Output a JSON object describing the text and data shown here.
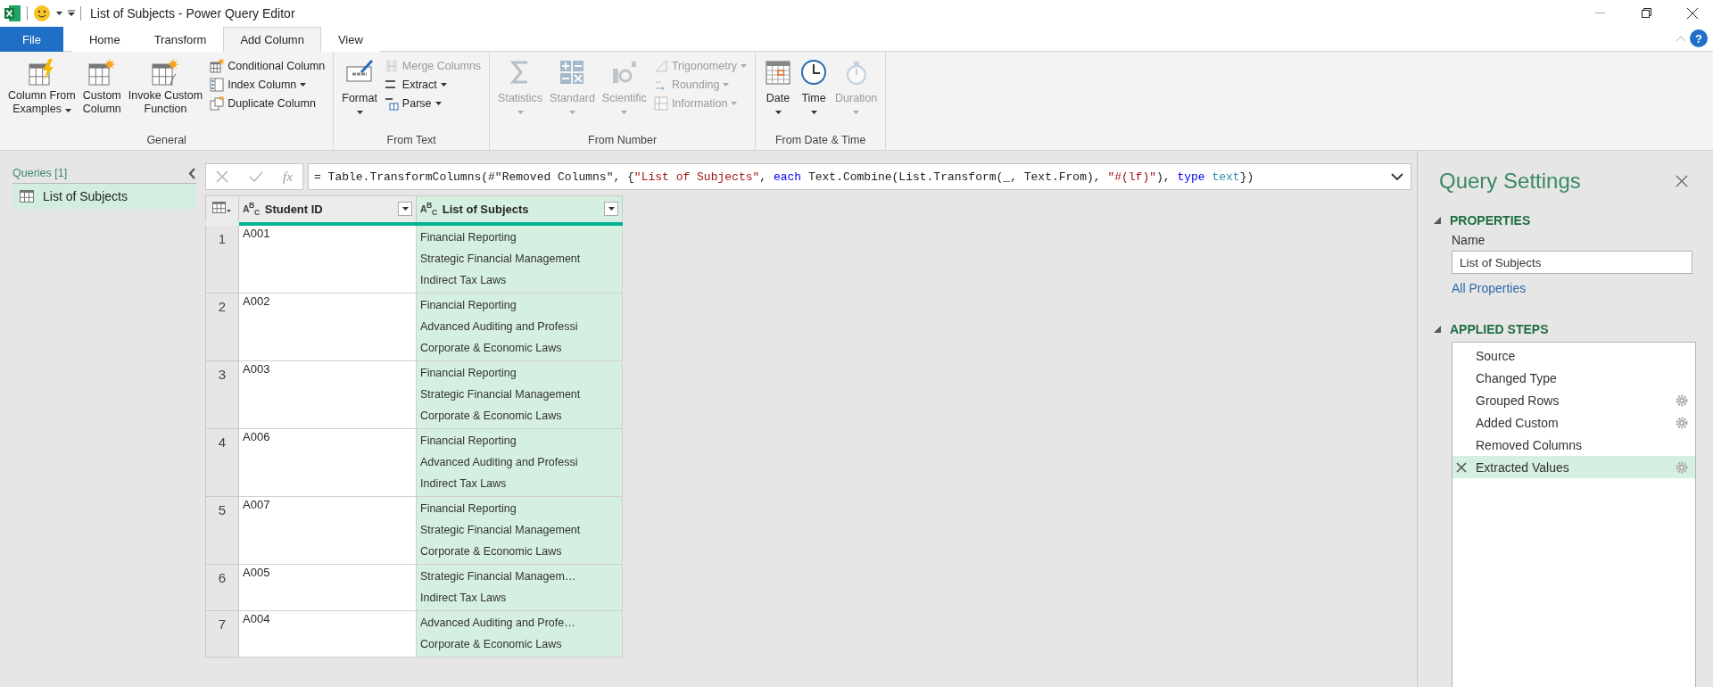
{
  "window": {
    "title": "List of Subjects - Power Query Editor"
  },
  "tabs": [
    {
      "label": "File",
      "kind": "file",
      "selected": false
    },
    {
      "label": "Home",
      "kind": "tab",
      "selected": false
    },
    {
      "label": "Transform",
      "kind": "tab",
      "selected": false
    },
    {
      "label": "Add Column",
      "kind": "tab",
      "selected": true
    },
    {
      "label": "View",
      "kind": "tab",
      "selected": false
    }
  ],
  "help": {
    "label": "?"
  },
  "ribbon_groups": [
    {
      "label": "General",
      "items": [
        {
          "kind": "large",
          "label_lines": [
            "Column From",
            "Examples"
          ],
          "dropdown": true,
          "disabled": false
        },
        {
          "kind": "large",
          "label_lines": [
            "Custom",
            "Column"
          ],
          "dropdown": false,
          "disabled": false
        },
        {
          "kind": "large",
          "label_lines": [
            "Invoke Custom",
            "Function"
          ],
          "dropdown": false,
          "disabled": false
        },
        {
          "kind": "small",
          "label_lines": [
            "Conditional Column"
          ],
          "dropdown": false,
          "disabled": false
        },
        {
          "kind": "small",
          "label_lines": [
            "Index Column"
          ],
          "dropdown": true,
          "disabled": false
        },
        {
          "kind": "small",
          "label_lines": [
            "Duplicate Column"
          ],
          "dropdown": false,
          "disabled": false
        }
      ]
    },
    {
      "label": "From Text",
      "items": [
        {
          "kind": "large",
          "label_lines": [
            "Format"
          ],
          "dropdown": true,
          "disabled": false
        },
        {
          "kind": "small",
          "label_lines": [
            "Merge Columns"
          ],
          "dropdown": false,
          "disabled": true
        },
        {
          "kind": "small",
          "label_lines": [
            "Extract"
          ],
          "dropdown": true,
          "disabled": false
        },
        {
          "kind": "small",
          "label_lines": [
            "Parse"
          ],
          "dropdown": true,
          "disabled": false
        }
      ]
    },
    {
      "label": "From Number",
      "items": [
        {
          "kind": "large",
          "label_lines": [
            "Statistics"
          ],
          "dropdown": true,
          "disabled": true
        },
        {
          "kind": "large",
          "label_lines": [
            "Standard"
          ],
          "dropdown": true,
          "disabled": true
        },
        {
          "kind": "large",
          "label_lines": [
            "Scientific"
          ],
          "dropdown": true,
          "disabled": true
        },
        {
          "kind": "small",
          "label_lines": [
            "Trigonometry"
          ],
          "dropdown": true,
          "disabled": true
        },
        {
          "kind": "small",
          "label_lines": [
            "Rounding"
          ],
          "dropdown": true,
          "disabled": true
        },
        {
          "kind": "small",
          "label_lines": [
            "Information"
          ],
          "dropdown": true,
          "disabled": true
        }
      ]
    },
    {
      "label": "From Date & Time",
      "items": [
        {
          "kind": "large",
          "label_lines": [
            "Date"
          ],
          "dropdown": true,
          "disabled": false
        },
        {
          "kind": "large",
          "label_lines": [
            "Time"
          ],
          "dropdown": true,
          "disabled": false
        },
        {
          "kind": "large",
          "label_lines": [
            "Duration"
          ],
          "dropdown": true,
          "disabled": true
        }
      ]
    }
  ],
  "queries": {
    "title": "Queries [1]",
    "items": [
      {
        "name": "List of Subjects",
        "selected": true
      }
    ]
  },
  "formula_bar": {
    "function_label": "fx",
    "tokens": [
      {
        "text": "= Table.TransformColumns(#\"Removed Columns\", {",
        "kind": "plain"
      },
      {
        "text": "\"List of Subjects\"",
        "kind": "string"
      },
      {
        "text": ", ",
        "kind": "plain"
      },
      {
        "text": "each",
        "kind": "keyword"
      },
      {
        "text": " Text.Combine(List.Transform(_, Text.From), ",
        "kind": "plain"
      },
      {
        "text": "\"#(lf)\"",
        "kind": "string"
      },
      {
        "text": "), ",
        "kind": "plain"
      },
      {
        "text": "type",
        "kind": "keyword"
      },
      {
        "text": " text",
        "kind": "type"
      },
      {
        "text": "})",
        "kind": "plain"
      }
    ]
  },
  "table": {
    "columns": [
      {
        "name": "Student ID",
        "type_label": "A$^{B}$$_{C}$",
        "selected": false
      },
      {
        "name": "List of Subjects",
        "type_label": "A$^{B}$$_{C}$",
        "selected": true
      }
    ],
    "rows": [
      {
        "number": "1",
        "id": "A001",
        "subjects": [
          "Financial Reporting",
          "Strategic Financial Management",
          "Indirect Tax Laws"
        ]
      },
      {
        "number": "2",
        "id": "A002",
        "subjects": [
          "Financial Reporting",
          "Advanced Auditing and Professi",
          "Corporate & Economic Laws"
        ]
      },
      {
        "number": "3",
        "id": "A003",
        "subjects": [
          "Financial Reporting",
          "Strategic Financial Management",
          "Corporate & Economic Laws"
        ]
      },
      {
        "number": "4",
        "id": "A006",
        "subjects": [
          "Financial Reporting",
          "Advanced Auditing and Professi",
          "Indirect Tax Laws"
        ]
      },
      {
        "number": "5",
        "id": "A007",
        "subjects": [
          "Financial Reporting",
          "Strategic Financial Management",
          "Corporate & Economic Laws"
        ]
      },
      {
        "number": "6",
        "id": "A005",
        "subjects": [
          "Strategic Financial Managem…",
          "Indirect Tax Laws"
        ]
      },
      {
        "number": "7",
        "id": "A004",
        "subjects": [
          "Advanced Auditing and Profe…",
          "Corporate & Economic Laws"
        ]
      }
    ]
  },
  "query_settings": {
    "title": "Query Settings",
    "properties_heading": "PROPERTIES",
    "properties_expanded": true,
    "name_label": "Name",
    "name_value": "List of Subjects",
    "all_properties": "All Properties",
    "steps_heading": "APPLIED STEPS",
    "steps_expanded": true,
    "steps": [
      {
        "name": "Source",
        "selected": false,
        "settings": false
      },
      {
        "name": "Changed Type",
        "selected": false,
        "settings": false
      },
      {
        "name": "Grouped Rows",
        "selected": false,
        "settings": true
      },
      {
        "name": "Added Custom",
        "selected": false,
        "settings": true
      },
      {
        "name": "Removed Columns",
        "selected": false,
        "settings": false
      },
      {
        "name": "Extracted Values",
        "selected": true,
        "settings": true
      }
    ]
  }
}
